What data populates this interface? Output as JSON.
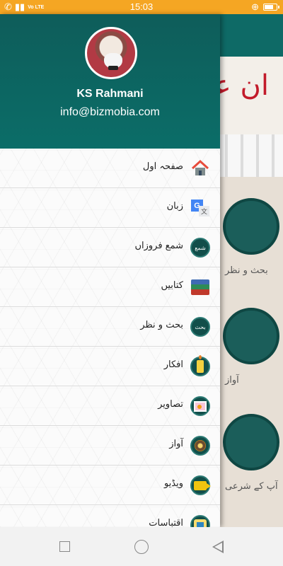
{
  "status_bar": {
    "time": "15:03",
    "network": "Vo LTE"
  },
  "drawer": {
    "user_name": "KS Rahmani",
    "user_email": "info@bizmobia.com",
    "items": [
      {
        "label": "صفحہ اول",
        "icon": "home-icon"
      },
      {
        "label": "زبان",
        "icon": "translate-icon"
      },
      {
        "label": "شمع فروزاں",
        "icon": "shama-frozan-logo-icon"
      },
      {
        "label": "کتابیں",
        "icon": "books-icon"
      },
      {
        "label": "بحث و نظر",
        "icon": "bahs-o-nazar-logo-icon"
      },
      {
        "label": "افکار",
        "icon": "candle-icon"
      },
      {
        "label": "تصاویر",
        "icon": "photo-icon"
      },
      {
        "label": "آواز",
        "icon": "speaker-icon"
      },
      {
        "label": "ویڈیو",
        "icon": "video-camera-icon"
      },
      {
        "label": "اقتباسات",
        "icon": "quote-book-icon"
      }
    ]
  },
  "background": {
    "banner_text": "ان عام",
    "labels": [
      "بحث و نظر",
      "آواز",
      "آپ کے شرعی"
    ]
  },
  "colors": {
    "status_bar": "#f5a623",
    "header": "#0b6d68",
    "accent_dark": "#124e4a"
  }
}
